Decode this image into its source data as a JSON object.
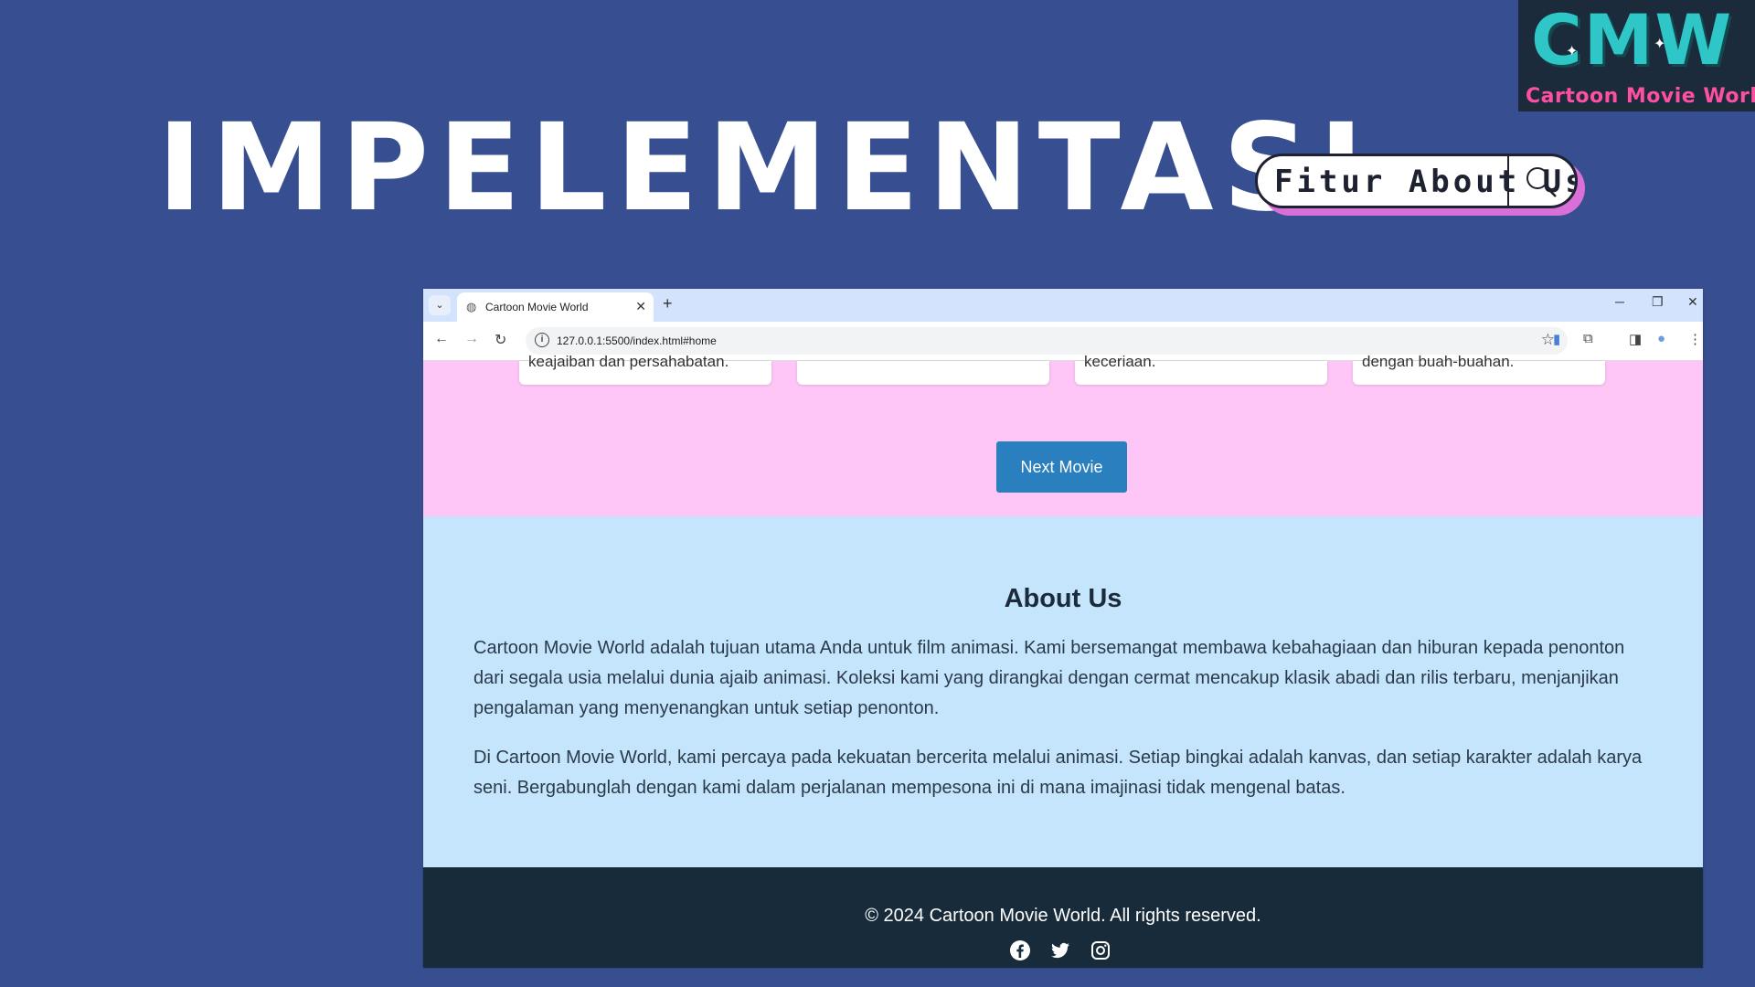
{
  "slide": {
    "title": "IMPELEMENTASI",
    "feature_label": "Fitur About Us",
    "logo": {
      "mark": "CMW",
      "text": "Cartoon Movie World"
    }
  },
  "browser": {
    "tab_title": "Cartoon Movie World",
    "url": "127.0.0.1:5500/index.html#home"
  },
  "movies": {
    "card_snippets": [
      "keajaiban dan persahabatan.",
      "",
      "keceriaan.",
      "dengan buah-buahan."
    ],
    "next_button": "Next Movie"
  },
  "about": {
    "title": "About Us",
    "paragraphs": [
      "Cartoon Movie World adalah tujuan utama Anda untuk film animasi. Kami bersemangat membawa kebahagiaan dan hiburan kepada penonton dari segala usia melalui dunia ajaib animasi. Koleksi kami yang dirangkai dengan cermat mencakup klasik abadi dan rilis terbaru, menjanjikan pengalaman yang menyenangkan untuk setiap penonton.",
      "Di Cartoon Movie World, kami percaya pada kekuatan bercerita melalui animasi. Setiap bingkai adalah kanvas, dan setiap karakter adalah karya seni. Bergabunglah dengan kami dalam perjalanan mempesona ini di mana imajinasi tidak mengenal batas."
    ]
  },
  "footer": {
    "copyright": "© 2024 Cartoon Movie World. All rights reserved.",
    "social_icons": [
      "facebook-icon",
      "twitter-icon",
      "instagram-icon"
    ]
  },
  "colors": {
    "slide_bg": "#374f90",
    "pink_section": "#fec6f6",
    "about_bg": "#c4e5fc",
    "footer_bg": "#172b3a",
    "button_blue": "#2a7fbf"
  }
}
